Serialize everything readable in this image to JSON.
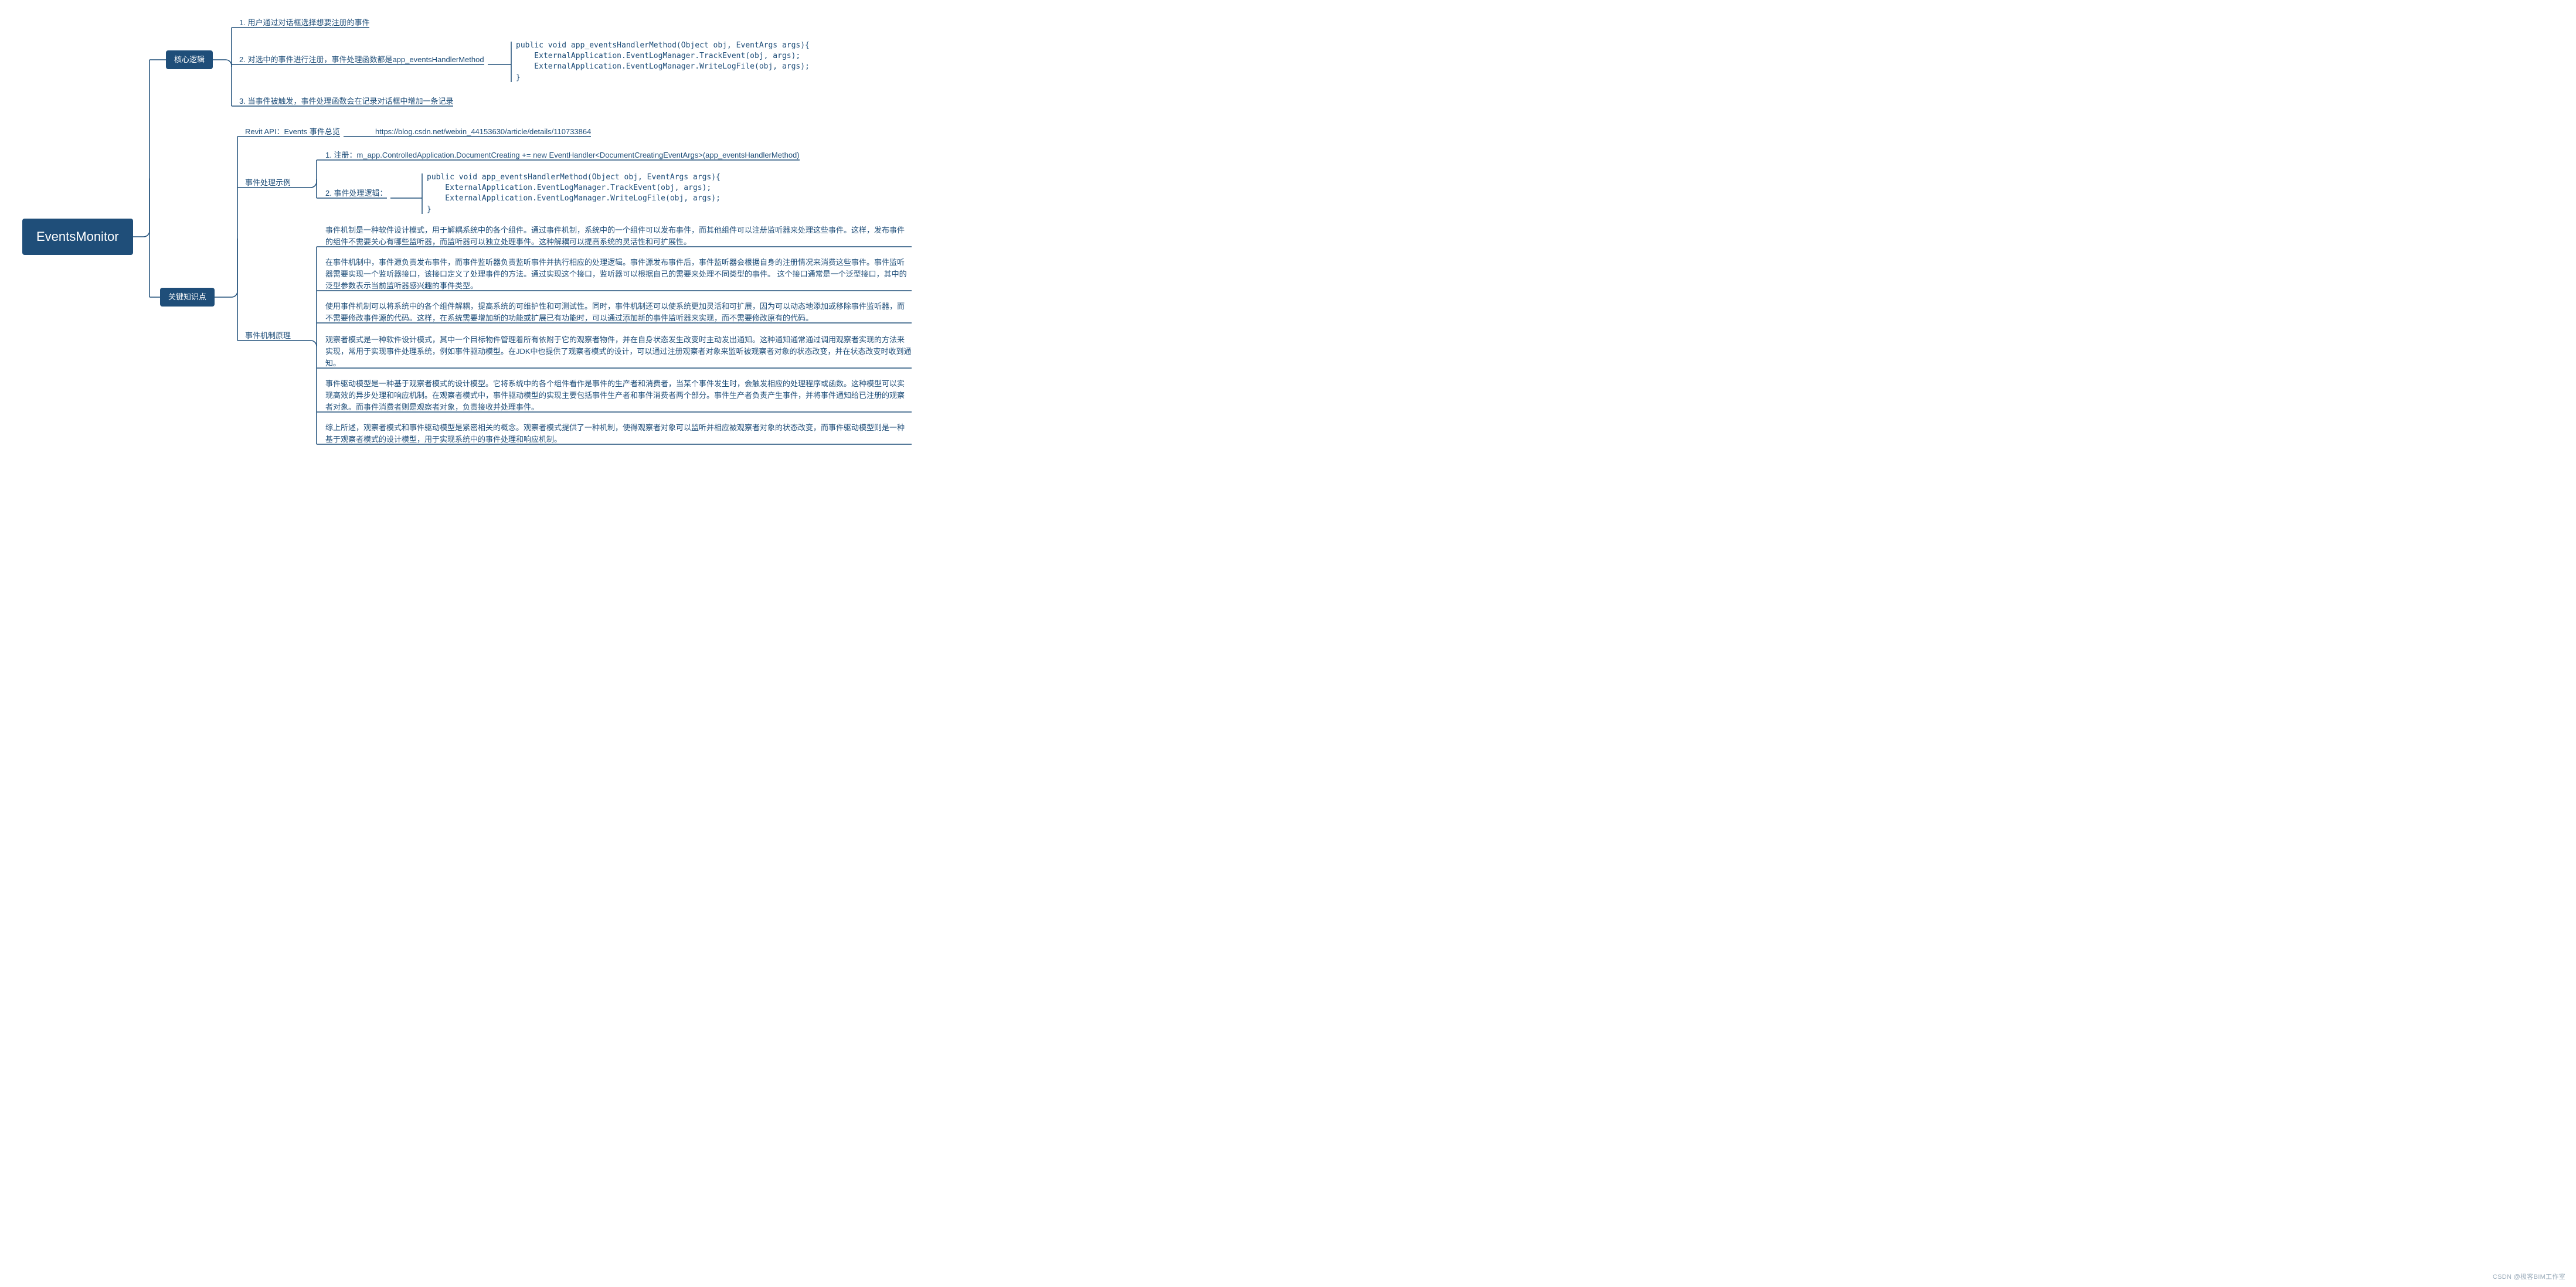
{
  "root": {
    "label": "EventsMonitor"
  },
  "coreLogic": {
    "label": "核心逻辑",
    "items": {
      "n1": "1. 用户通过对话框选择想要注册的事件",
      "n2": "2. 对选中的事件进行注册，事件处理函数都是app_eventsHandlerMethod",
      "n3": "3. 当事件被触发，事件处理函数会在记录对话框中增加一条记录",
      "code": "public void app_eventsHandlerMethod(Object obj, EventArgs args){\n    ExternalApplication.EventLogManager.TrackEvent(obj, args);\n    ExternalApplication.EventLogManager.WriteLogFile(obj, args);\n}"
    }
  },
  "keyPoints": {
    "label": "关键知识点",
    "revit": {
      "label": "Revit API：Events 事件总览",
      "link": "https://blog.csdn.net/weixin_44153630/article/details/110733864"
    },
    "example": {
      "label": "事件处理示例",
      "reg": "1. 注册：m_app.ControlledApplication.DocumentCreating += new EventHandler<DocumentCreatingEventArgs>(app_eventsHandlerMethod)",
      "logicLabel": "2. 事件处理逻辑：",
      "code": "public void app_eventsHandlerMethod(Object obj, EventArgs args){\n    ExternalApplication.EventLogManager.TrackEvent(obj, args);\n    ExternalApplication.EventLogManager.WriteLogFile(obj, args);\n}"
    },
    "mechanism": {
      "label": "事件机制原理",
      "p1": "事件机制是一种软件设计模式，用于解耦系统中的各个组件。通过事件机制，系统中的一个组件可以发布事件，而其他组件可以注册监听器来处理这些事件。这样，发布事件的组件不需要关心有哪些监听器，而监听器可以独立处理事件。这种解耦可以提高系统的灵活性和可扩展性。",
      "p2": "在事件机制中，事件源负责发布事件，而事件监听器负责监听事件并执行相应的处理逻辑。事件源发布事件后，事件监听器会根据自身的注册情况来消费这些事件。事件监听器需要实现一个监听器接口，该接口定义了处理事件的方法。通过实现这个接口，监听器可以根据自己的需要来处理不同类型的事件。 这个接口通常是一个泛型接口，其中的泛型参数表示当前监听器感兴趣的事件类型。",
      "p3": "使用事件机制可以将系统中的各个组件解耦，提高系统的可维护性和可测试性。同时，事件机制还可以使系统更加灵活和可扩展，因为可以动态地添加或移除事件监听器，而不需要修改事件源的代码。这样，在系统需要增加新的功能或扩展已有功能时，可以通过添加新的事件监听器来实现，而不需要修改原有的代码。",
      "p4": "观察者模式是一种软件设计模式，其中一个目标物件管理着所有依附于它的观察者物件，并在自身状态发生改变时主动发出通知。这种通知通常通过调用观察者实现的方法来实现，常用于实现事件处理系统，例如事件驱动模型。在JDK中也提供了观察者模式的设计，可以通过注册观察者对象来监听被观察者对象的状态改变，并在状态改变时收到通知。",
      "p5": "事件驱动模型是一种基于观察者模式的设计模型。它将系统中的各个组件看作是事件的生产者和消费者，当某个事件发生时，会触发相应的处理程序或函数。这种模型可以实现高效的异步处理和响应机制。在观察者模式中，事件驱动模型的实现主要包括事件生产者和事件消费者两个部分。事件生产者负责产生事件，并将事件通知给已注册的观察者对象。而事件消费者则是观察者对象，负责接收并处理事件。",
      "p6": "综上所述，观察者模式和事件驱动模型是紧密相关的概念。观察者模式提供了一种机制，使得观察者对象可以监听并相应被观察者对象的状态改变，而事件驱动模型则是一种基于观察者模式的设计模型，用于实现系统中的事件处理和响应机制。"
    }
  },
  "watermark": "CSDN @极客BIM工作室"
}
